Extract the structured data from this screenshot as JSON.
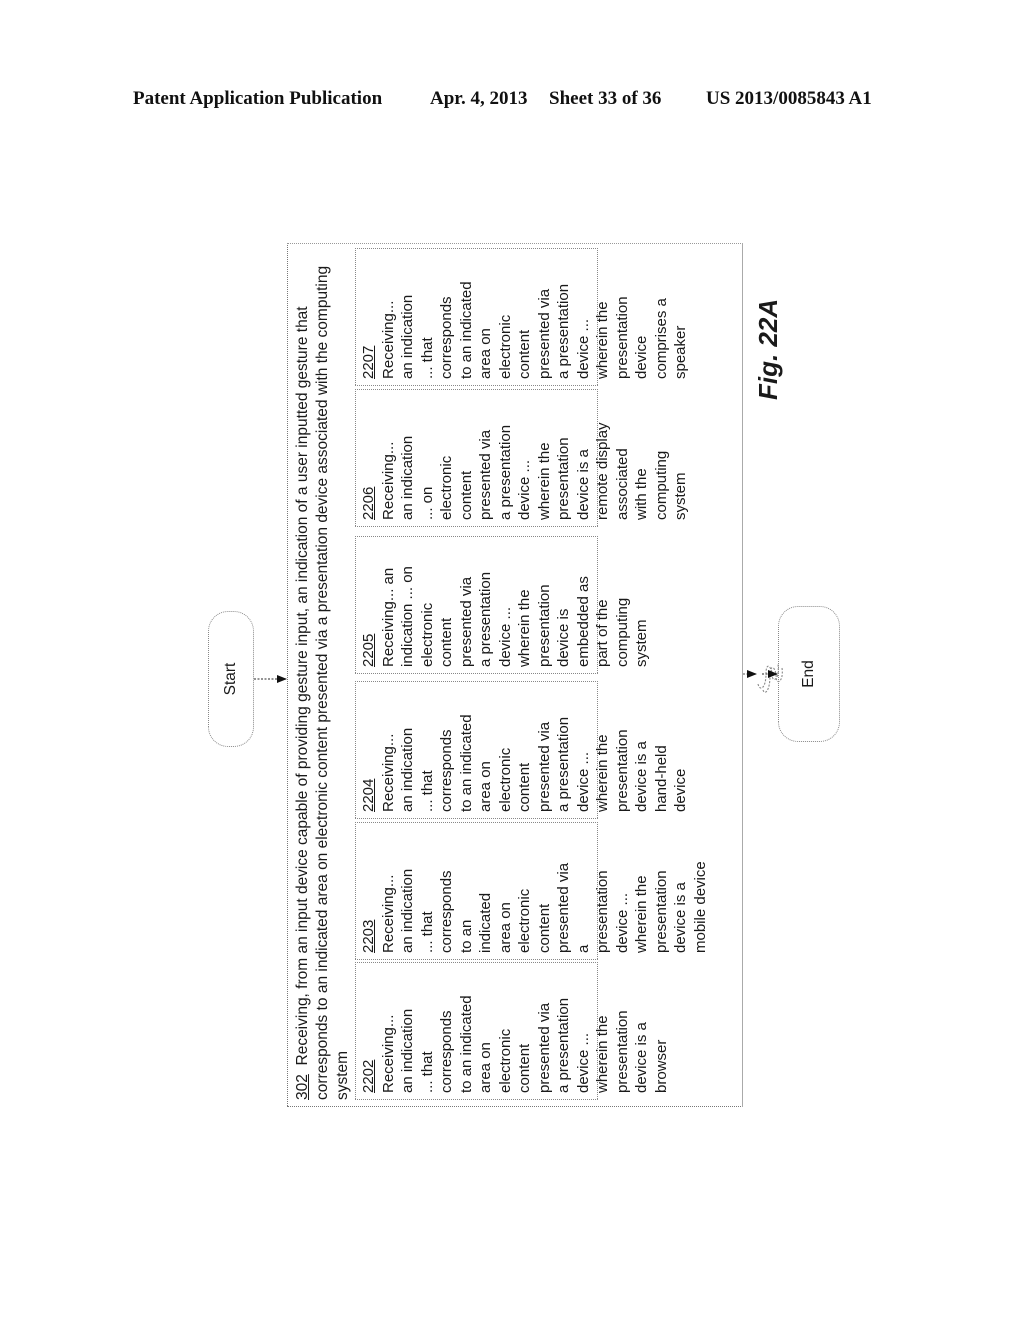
{
  "header": {
    "publication": "Patent Application Publication",
    "date": "Apr. 4, 2013",
    "sheet": "Sheet 33 of 36",
    "number": "US 2013/0085843 A1"
  },
  "diagram": {
    "start_label": "Start",
    "end_label": "End",
    "figure_label": "Fig. 22A",
    "main_step": {
      "id": "302",
      "text": "Receiving, from an input device capable of providing gesture input, an indication of a user inputted gesture that corresponds to an indicated area on electronic content presented via a presentation device associated with the computing system"
    },
    "sub_steps": [
      {
        "id": "2202",
        "lines": [
          "Receiving...",
          "an indication",
          "... that",
          "corresponds",
          "to an indicated",
          "area on",
          "electronic",
          "content",
          "presented via",
          "a presentation",
          "device ...",
          "wherein the",
          "presentation",
          "device is a",
          "browser"
        ]
      },
      {
        "id": "2203",
        "lines": [
          "Receiving...",
          "an indication",
          "... that",
          "corresponds",
          "to an",
          "indicated",
          "area on",
          "electronic",
          "content",
          "presented via",
          "a",
          "presentation",
          "device ...",
          "wherein the",
          "presentation",
          "device is a",
          "mobile device"
        ]
      },
      {
        "id": "2204",
        "lines": [
          "Receiving...",
          "an indication",
          "... that",
          "corresponds",
          "to an indicated",
          "area on",
          "electronic",
          "content",
          "presented via",
          "a presentation",
          "device ...",
          "wherein the",
          "presentation",
          "device is a",
          "hand-held",
          "device"
        ]
      },
      {
        "id": "2205",
        "lines": [
          "Receiving... an",
          "indication ... on",
          "electronic",
          "content",
          "presented via",
          "a presentation",
          "device ...",
          "wherein the",
          "presentation",
          "device is",
          "embedded as",
          "part of the",
          "computing",
          "system"
        ]
      },
      {
        "id": "2206",
        "lines": [
          "Receiving...",
          "an indication",
          "... on",
          "electronic",
          "content",
          "presented via",
          "a presentation",
          "device ...",
          "wherein the",
          "presentation",
          "device is a",
          "remote display",
          "associated",
          "with the",
          "computing",
          "system"
        ]
      },
      {
        "id": "2207",
        "lines": [
          "Receiving...",
          "an indication",
          "... that",
          "corresponds",
          "to an indicated",
          "area on",
          "electronic",
          "content",
          "presented via",
          "a presentation",
          "device ...",
          "wherein the",
          "presentation",
          "device",
          "comprises a",
          "speaker"
        ]
      }
    ]
  }
}
